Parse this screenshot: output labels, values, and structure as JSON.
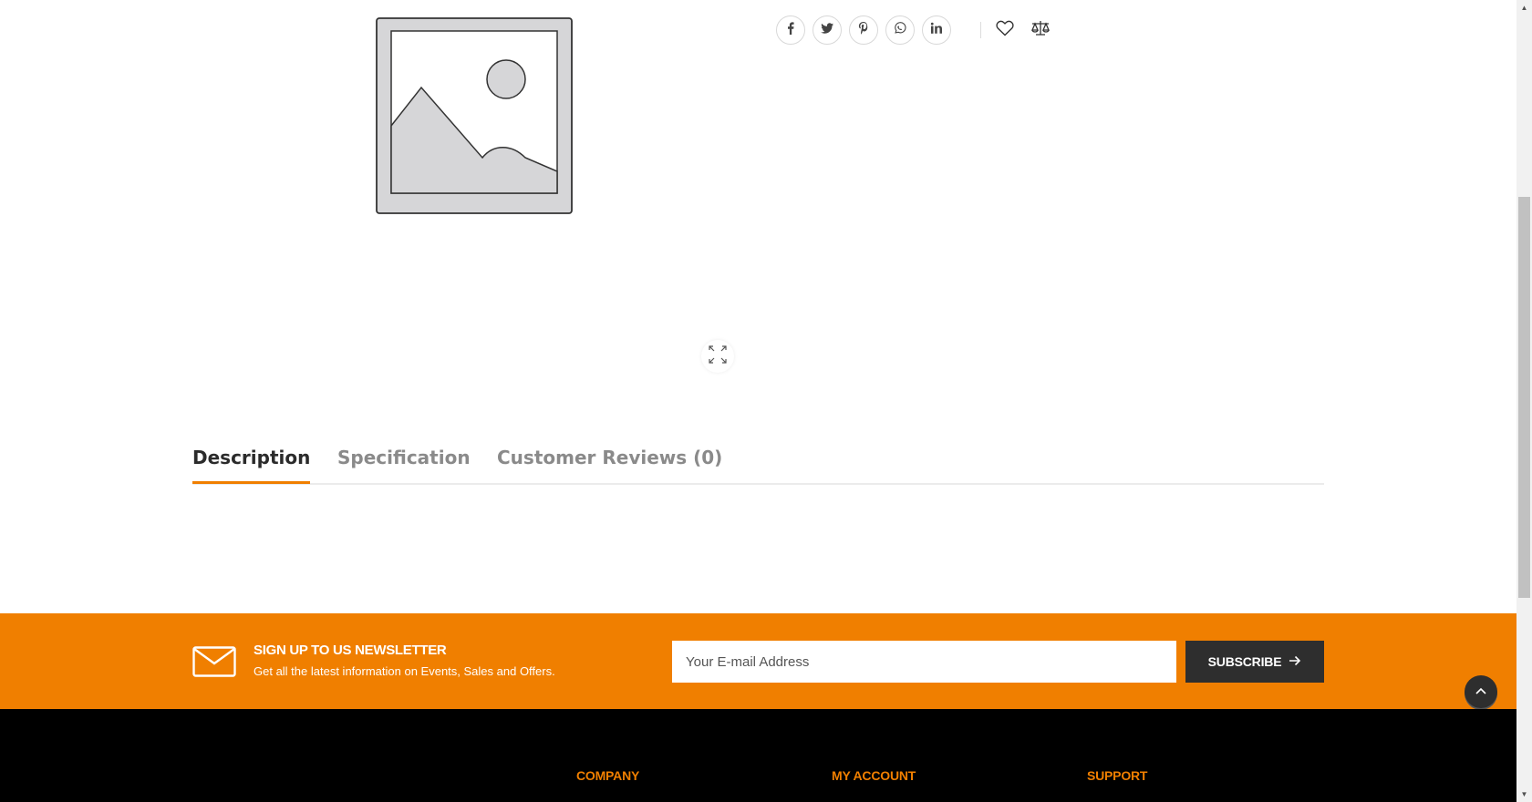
{
  "tabs": [
    {
      "label": "Description"
    },
    {
      "label": "Specification"
    },
    {
      "label": "Customer Reviews (0)"
    }
  ],
  "newsletter": {
    "title": "SIGN UP TO US NEWSLETTER",
    "subtitle": "Get all the latest information on Events, Sales and Offers.",
    "email_placeholder": "Your E-mail Address",
    "subscribe_label": "SUBSCRIBE"
  },
  "footer": {
    "headings": [
      "COMPANY",
      "MY ACCOUNT",
      "SUPPORT"
    ]
  },
  "share_icons": [
    "facebook-icon",
    "twitter-icon",
    "pinterest-icon",
    "whatsapp-icon",
    "linkedin-icon"
  ],
  "colors": {
    "accent": "#f07f00",
    "dark": "#2e2e2e",
    "footer_bg": "#000000"
  }
}
